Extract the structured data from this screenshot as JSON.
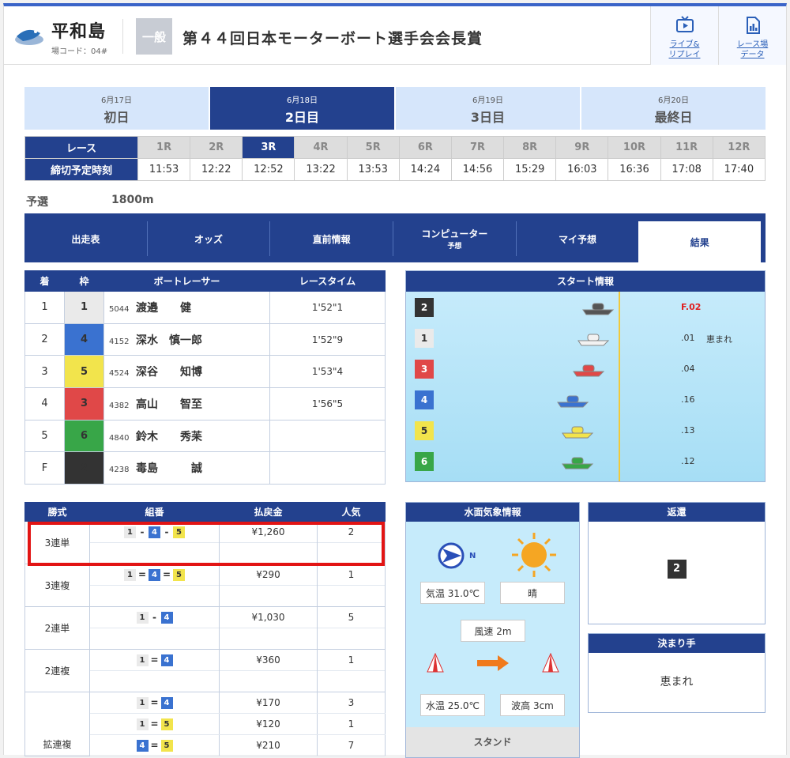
{
  "header": {
    "venue": "平和島",
    "venue_code": "場コード：04#",
    "grade": "一般",
    "race_title": "第４４回日本モーターボート選手会会長賞",
    "buttons": [
      {
        "label1": "ライブ&",
        "label2": "リプレイ",
        "icon": "tv-icon"
      },
      {
        "label1": "レース場",
        "label2": "データ",
        "icon": "chart-doc-icon"
      }
    ]
  },
  "days": [
    {
      "date": "6月17日",
      "name": "初日"
    },
    {
      "date": "6月18日",
      "name": "2日目"
    },
    {
      "date": "6月19日",
      "name": "3日目"
    },
    {
      "date": "6月20日",
      "name": "最終日"
    }
  ],
  "races": {
    "label": "レース",
    "time_label": "締切予定時刻",
    "list": [
      {
        "r": "1R",
        "t": "11:53"
      },
      {
        "r": "2R",
        "t": "12:22"
      },
      {
        "r": "3R",
        "t": "12:52"
      },
      {
        "r": "4R",
        "t": "13:22"
      },
      {
        "r": "5R",
        "t": "13:53"
      },
      {
        "r": "6R",
        "t": "14:24"
      },
      {
        "r": "7R",
        "t": "14:56"
      },
      {
        "r": "8R",
        "t": "15:29"
      },
      {
        "r": "9R",
        "t": "16:03"
      },
      {
        "r": "10R",
        "t": "16:36"
      },
      {
        "r": "11R",
        "t": "17:08"
      },
      {
        "r": "12R",
        "t": "17:40"
      }
    ]
  },
  "race_class": "予選",
  "distance": "1800m",
  "tabs": [
    {
      "label": "出走表"
    },
    {
      "label": "オッズ"
    },
    {
      "label": "直前情報"
    },
    {
      "label": "コンピューター",
      "sub": "予想"
    },
    {
      "label": "マイ予想"
    },
    {
      "label": "結果"
    }
  ],
  "results": {
    "headers": [
      "着",
      "枠",
      "ボートレーサー",
      "レースタイム"
    ],
    "rows": [
      {
        "rank": "1",
        "frame": "1",
        "reg": "5044",
        "name": "渡邉　　健",
        "time": "1'52\"1"
      },
      {
        "rank": "2",
        "frame": "4",
        "reg": "4152",
        "name": "深水　慎一郎",
        "time": "1'52\"9"
      },
      {
        "rank": "3",
        "frame": "5",
        "reg": "4524",
        "name": "深谷　　知博",
        "time": "1'53\"4"
      },
      {
        "rank": "4",
        "frame": "3",
        "reg": "4382",
        "name": "高山　　智至",
        "time": "1'56\"5"
      },
      {
        "rank": "5",
        "frame": "6",
        "reg": "4840",
        "name": "鈴木　　秀苿",
        "time": ""
      },
      {
        "rank": "F",
        "frame": "2",
        "reg": "4238",
        "name": "毒島　　　誠",
        "time": ""
      }
    ]
  },
  "start": {
    "title": "スタート情報",
    "rows": [
      {
        "frame": "2",
        "time": "F.02",
        "note": ""
      },
      {
        "frame": "1",
        "time": ".01",
        "note": "恵まれ"
      },
      {
        "frame": "3",
        "time": ".04",
        "note": ""
      },
      {
        "frame": "4",
        "time": ".16",
        "note": ""
      },
      {
        "frame": "5",
        "time": ".13",
        "note": ""
      },
      {
        "frame": "6",
        "time": ".12",
        "note": ""
      }
    ]
  },
  "payout": {
    "headers": [
      "勝式",
      "組番",
      "払戻金",
      "人気"
    ],
    "rows": [
      {
        "type": "3連単",
        "combo": [
          "1",
          "-",
          "4",
          "-",
          "5"
        ],
        "amount": "¥1,260",
        "pop": "2"
      },
      {
        "type": "3連複",
        "combo": [
          "1",
          "=",
          "4",
          "=",
          "5"
        ],
        "amount": "¥290",
        "pop": "1"
      },
      {
        "type": "2連単",
        "combo": [
          "1",
          "-",
          "4"
        ],
        "amount": "¥1,030",
        "pop": "5"
      },
      {
        "type": "2連複",
        "combo": [
          "1",
          "=",
          "4"
        ],
        "amount": "¥360",
        "pop": "1"
      }
    ],
    "wide": {
      "type": "拡連複",
      "rows": [
        {
          "combo": [
            "1",
            "=",
            "4"
          ],
          "amount": "¥170",
          "pop": "3"
        },
        {
          "combo": [
            "1",
            "=",
            "5"
          ],
          "amount": "¥120",
          "pop": "1"
        },
        {
          "combo": [
            "4",
            "=",
            "5"
          ],
          "amount": "¥210",
          "pop": "7"
        }
      ]
    }
  },
  "weather": {
    "title": "水面気象情報",
    "wind_dir": "N",
    "air": "気温 31.0℃",
    "condition": "晴",
    "wind": "風速 2m",
    "water": "水温 25.0℃",
    "wave": "波高 3cm",
    "stand": "スタンド"
  },
  "refund": {
    "title": "返還",
    "frame": "2"
  },
  "kimarite": {
    "title": "決まり手",
    "value": "恵まれ"
  },
  "colors": {
    "navy": "#23418e",
    "frame1": "#eaeaea",
    "frame2": "#333333",
    "frame3": "#e04848",
    "frame4": "#3a72d0",
    "frame5": "#f2e44c",
    "frame6": "#38a648",
    "highlight": "#e21414"
  }
}
